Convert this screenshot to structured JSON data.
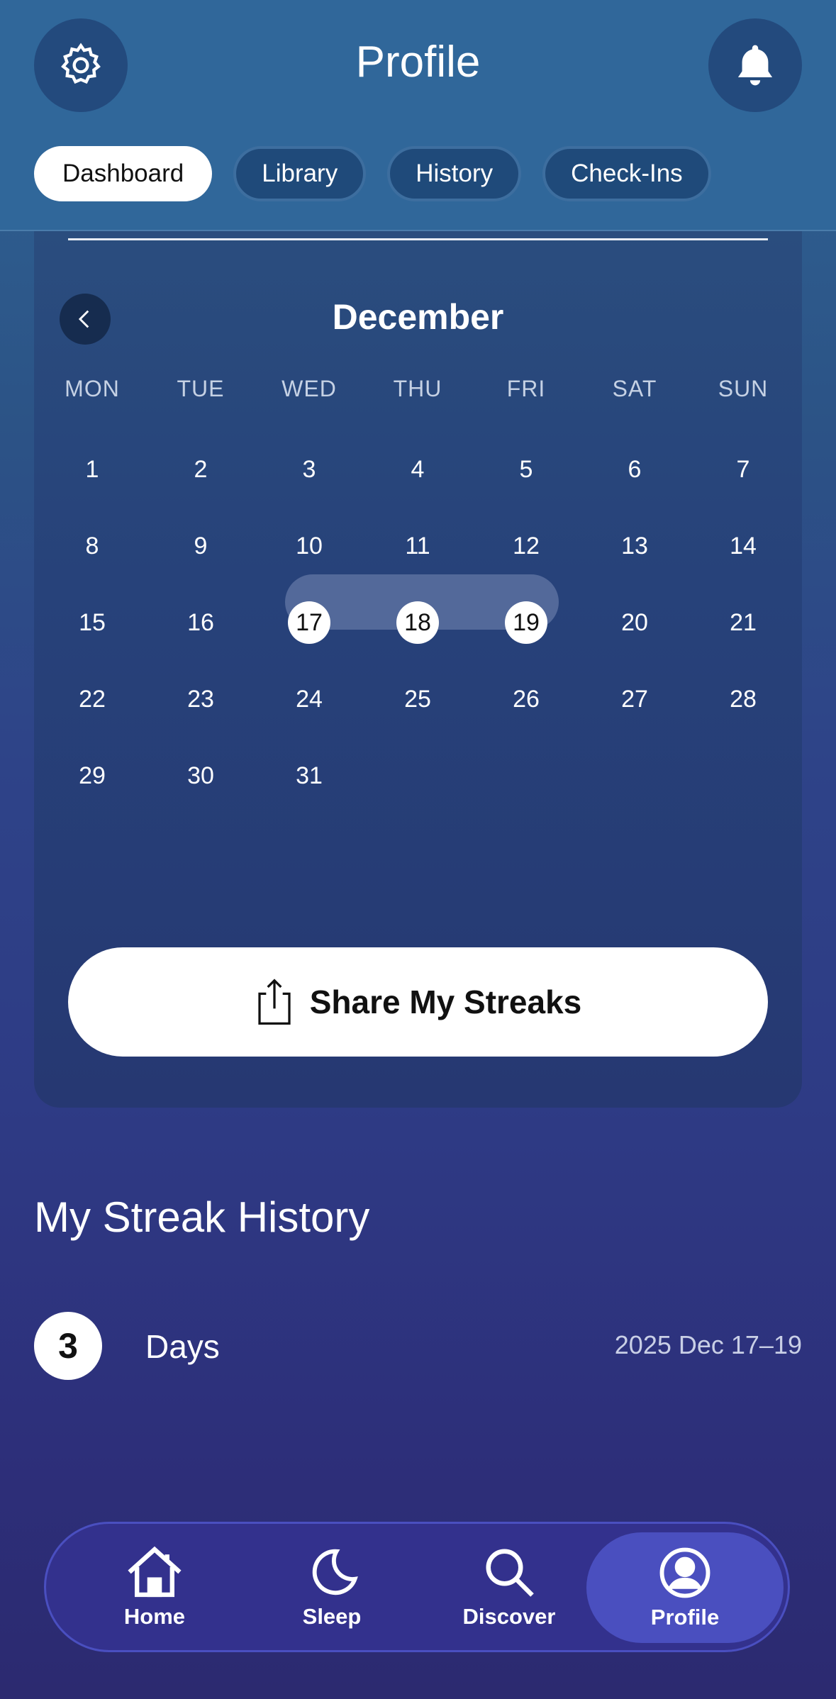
{
  "header": {
    "title": "Profile",
    "tabs": [
      {
        "label": "Dashboard",
        "active": true
      },
      {
        "label": "Library",
        "active": false
      },
      {
        "label": "History",
        "active": false
      },
      {
        "label": "Check-Ins",
        "active": false
      }
    ],
    "left_icon": "gear-icon",
    "right_icon": "bell-icon"
  },
  "calendar": {
    "month": "December",
    "weekdays": [
      "MON",
      "TUE",
      "WED",
      "THU",
      "FRI",
      "SAT",
      "SUN"
    ],
    "weeks": [
      [
        "1",
        "2",
        "3",
        "4",
        "5",
        "6",
        "7"
      ],
      [
        "8",
        "9",
        "10",
        "11",
        "12",
        "13",
        "14"
      ],
      [
        "15",
        "16",
        "17",
        "18",
        "19",
        "20",
        "21"
      ],
      [
        "22",
        "23",
        "24",
        "25",
        "26",
        "27",
        "28"
      ],
      [
        "29",
        "30",
        "31"
      ]
    ],
    "streak_days": [
      "17",
      "18",
      "19"
    ],
    "share_label": "Share My Streaks"
  },
  "history": {
    "title": "My Streak History",
    "items": [
      {
        "count": "3",
        "unit": "Days",
        "range": "2025 Dec 17–19"
      }
    ]
  },
  "nav": {
    "items": [
      {
        "label": "Home",
        "icon": "home-icon",
        "active": false
      },
      {
        "label": "Sleep",
        "icon": "moon-icon",
        "active": false
      },
      {
        "label": "Discover",
        "icon": "search-icon",
        "active": false
      },
      {
        "label": "Profile",
        "icon": "profile-icon",
        "active": true
      }
    ]
  },
  "colors": {
    "header_bg": "#30679a",
    "card_bg": "#2a4d7e",
    "nav_active": "#4a4fbf",
    "streak_band": "#53699a"
  }
}
